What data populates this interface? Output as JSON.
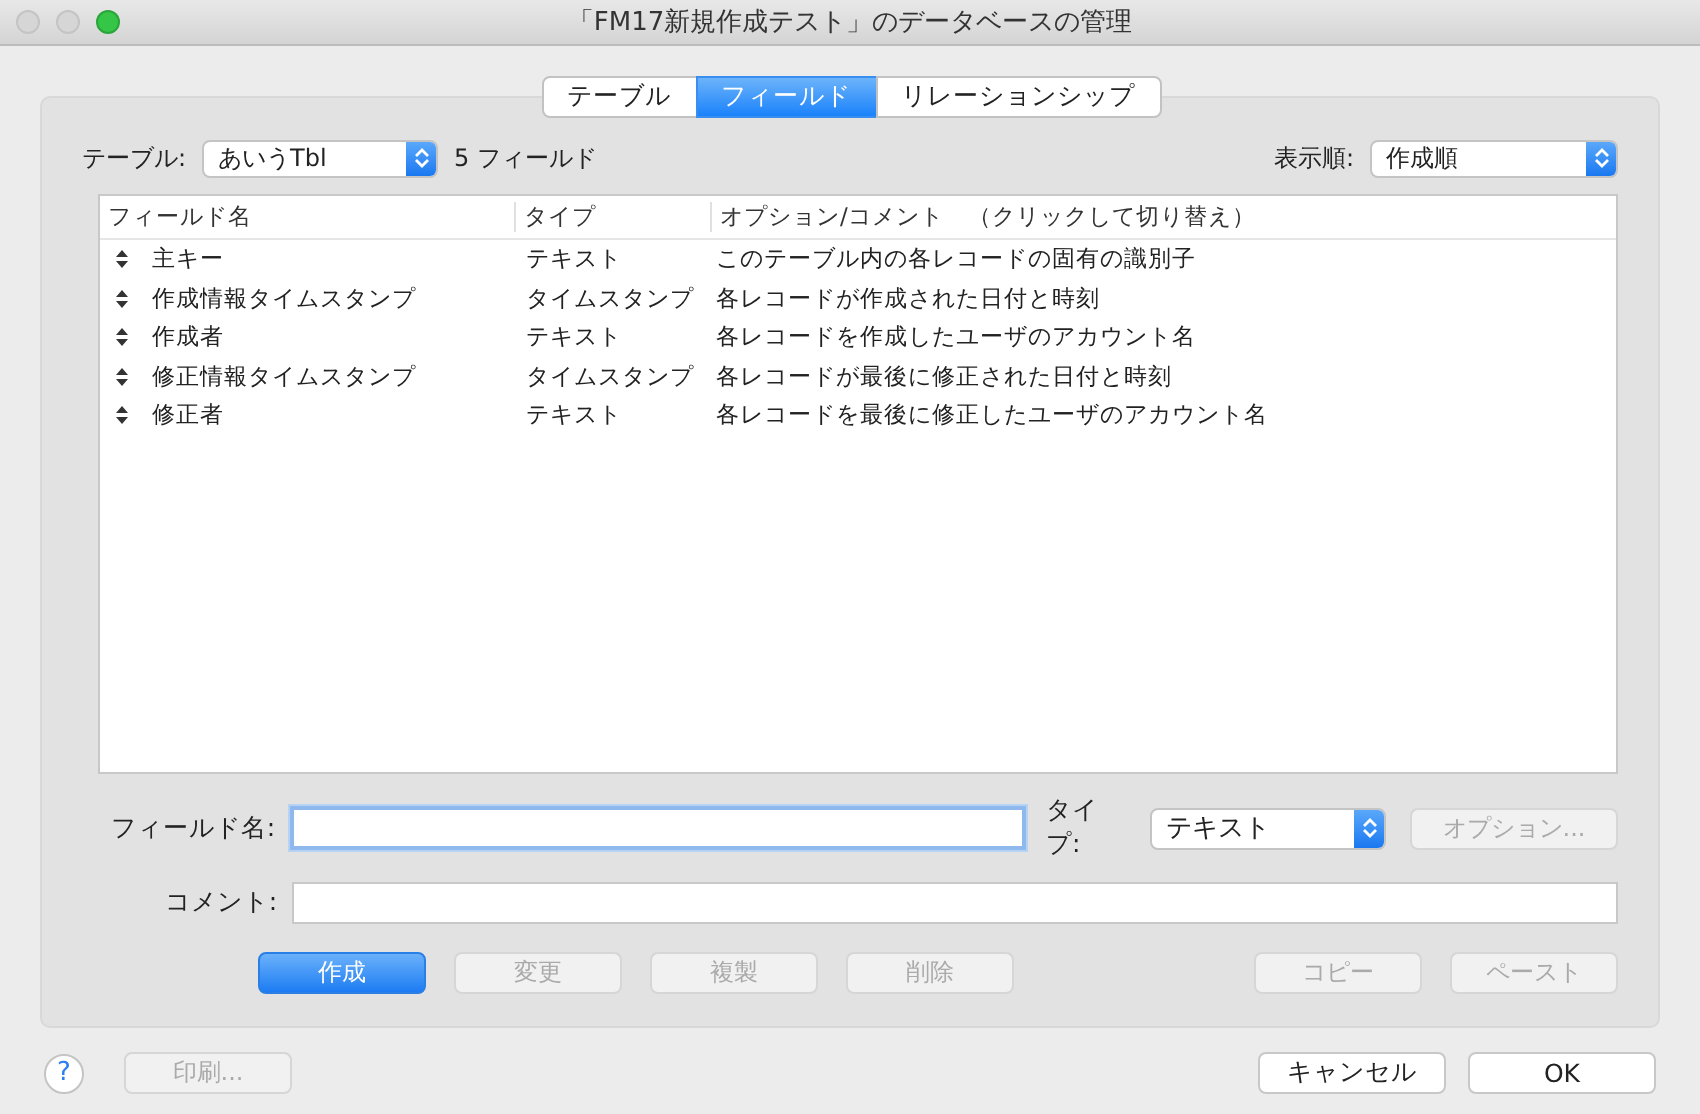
{
  "window": {
    "title": "「FM17新規作成テスト」のデータベースの管理"
  },
  "tabs": [
    {
      "label": "テーブル",
      "selected": false
    },
    {
      "label": "フィールド",
      "selected": true
    },
    {
      "label": "リレーションシップ",
      "selected": false
    }
  ],
  "table_selector": {
    "label": "テーブル:",
    "value": "あいうTbl",
    "count": "5 フィールド"
  },
  "sort": {
    "label": "表示順:",
    "value": "作成順"
  },
  "columns": [
    "フィールド名",
    "タイプ",
    "オプション/コメント　（クリックして切り替え）"
  ],
  "rows": [
    {
      "name": "主キー",
      "type": "テキスト",
      "comment": "このテーブル内の各レコードの固有の識別子"
    },
    {
      "name": "作成情報タイムスタンプ",
      "type": "タイムスタンプ",
      "comment": "各レコードが作成された日付と時刻"
    },
    {
      "name": "作成者",
      "type": "テキスト",
      "comment": "各レコードを作成したユーザのアカウント名"
    },
    {
      "name": "修正情報タイムスタンプ",
      "type": "タイムスタンプ",
      "comment": "各レコードが最後に修正された日付と時刻"
    },
    {
      "name": "修正者",
      "type": "テキスト",
      "comment": "各レコードを最後に修正したユーザのアカウント名"
    }
  ],
  "field_name": {
    "label": "フィールド名:"
  },
  "type_select": {
    "label": "タイプ:",
    "value": "テキスト"
  },
  "options_button": {
    "label": "オプション...",
    "disabled": true
  },
  "comment": {
    "label": "コメント:"
  },
  "action_buttons": [
    {
      "label": "作成",
      "disabled": false,
      "kind": "primary"
    },
    {
      "label": "変更",
      "disabled": true,
      "kind": "normal"
    },
    {
      "label": "複製",
      "disabled": true,
      "kind": "normal"
    },
    {
      "label": "削除",
      "disabled": true,
      "kind": "normal"
    }
  ],
  "clipboard_buttons": [
    {
      "label": "コピー",
      "disabled": true
    },
    {
      "label": "ペースト",
      "disabled": true
    }
  ],
  "help": {
    "label": "?"
  },
  "print_button": {
    "label": "印刷...",
    "disabled": true
  },
  "footer_buttons": [
    {
      "label": "キャンセル"
    },
    {
      "label": "OK"
    }
  ]
}
